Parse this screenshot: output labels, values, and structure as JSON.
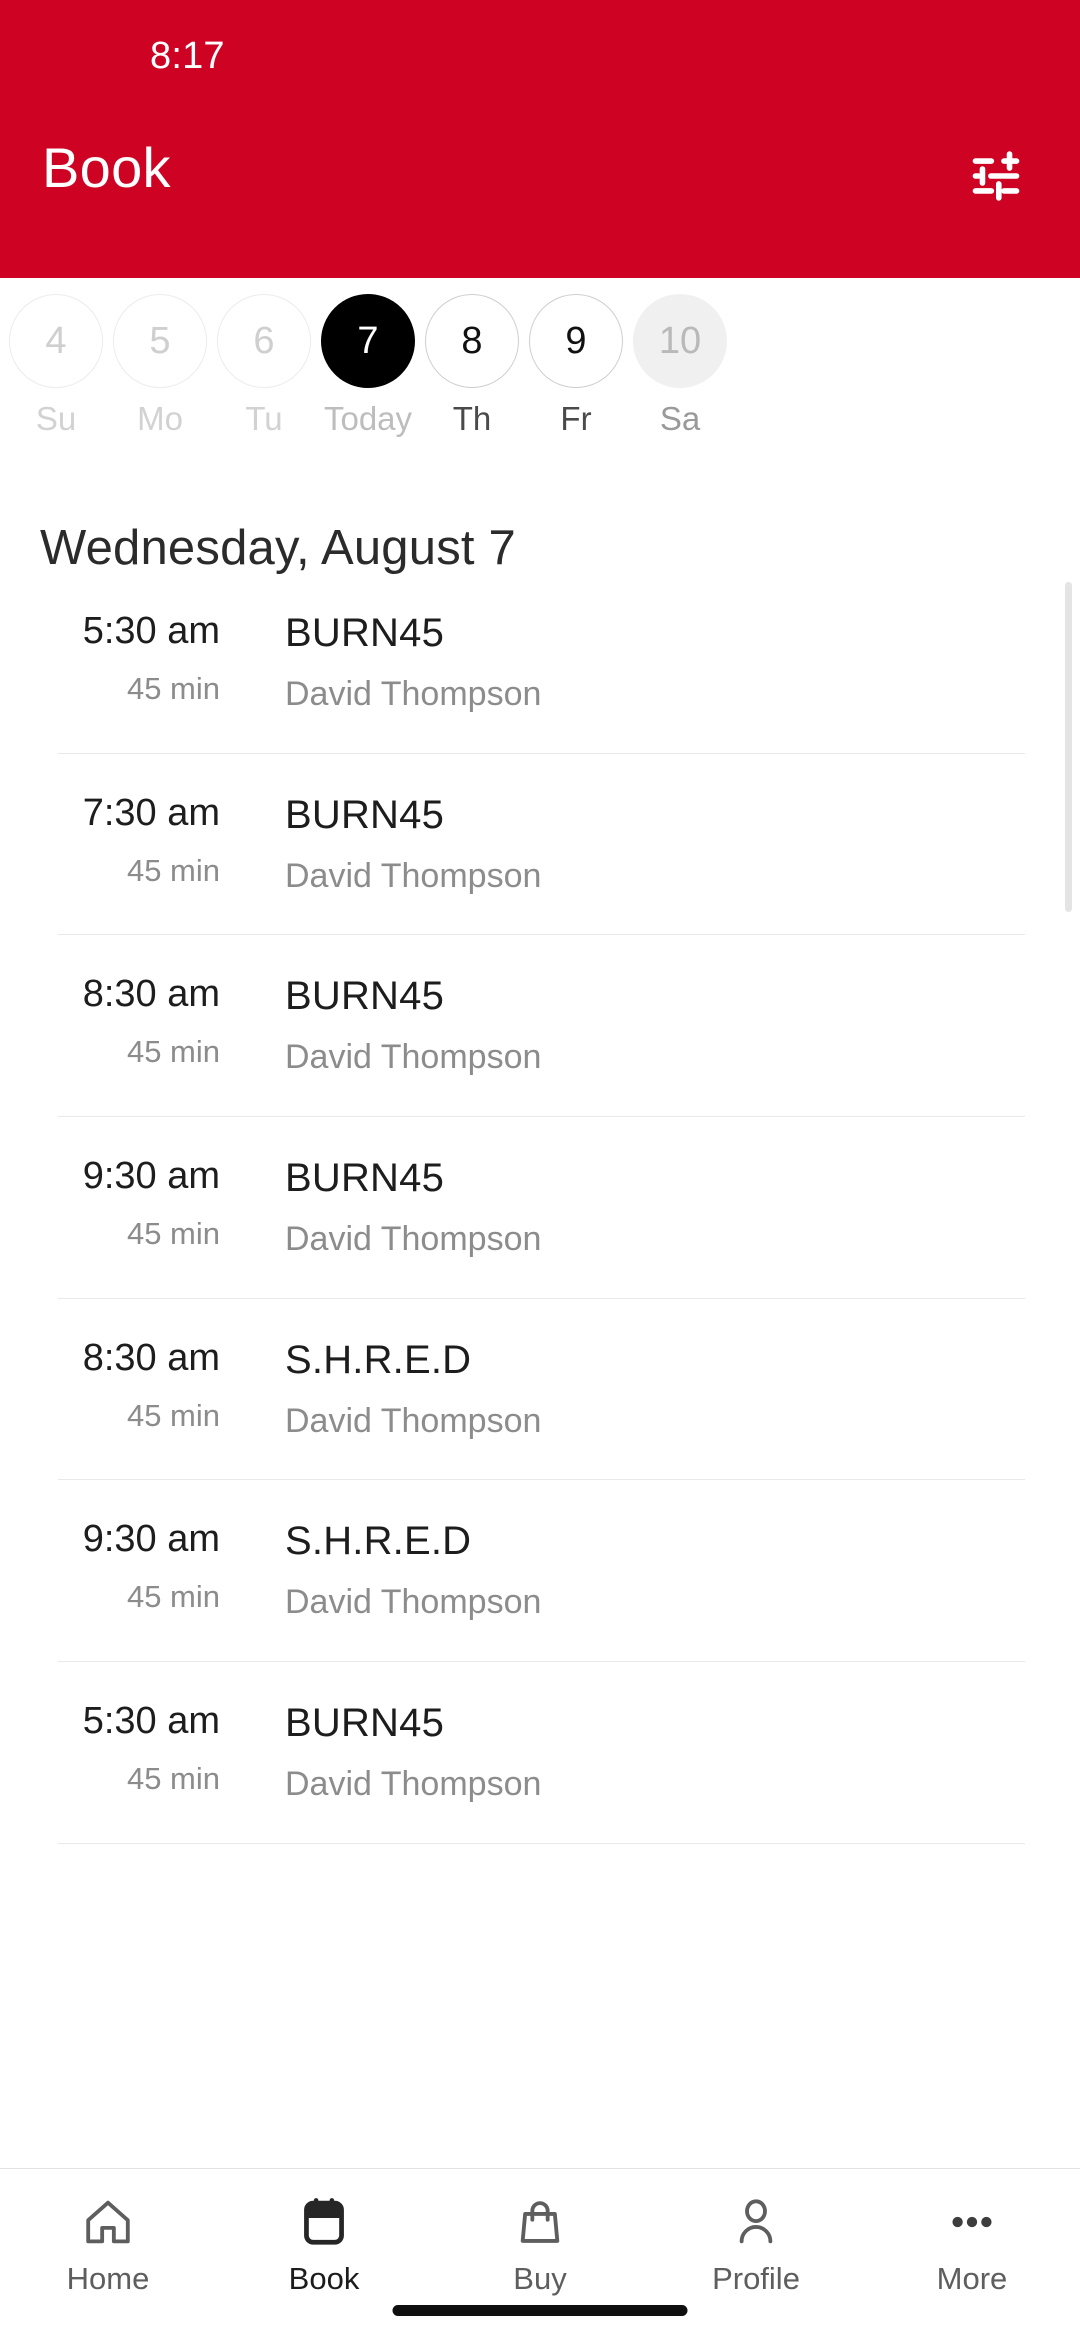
{
  "status_bar": {
    "time": "8:17"
  },
  "header": {
    "title": "Book",
    "filter_icon": "sliders-filter-icon",
    "background_color": "#CE0222",
    "text_color": "#FFFFFF"
  },
  "date_strip": {
    "days": [
      {
        "date": "4",
        "label": "Su",
        "state": "past"
      },
      {
        "date": "5",
        "label": "Mo",
        "state": "past"
      },
      {
        "date": "6",
        "label": "Tu",
        "state": "past"
      },
      {
        "date": "7",
        "label": "Today",
        "state": "today"
      },
      {
        "date": "8",
        "label": "Th",
        "state": "future"
      },
      {
        "date": "9",
        "label": "Fr",
        "state": "future"
      },
      {
        "date": "10",
        "label": "Sa",
        "state": "muted"
      }
    ]
  },
  "main": {
    "date_heading": "Wednesday, August 7",
    "classes": [
      {
        "time": "5:30 am",
        "duration": "45 min",
        "name": "BURN45",
        "instructor": "David Thompson"
      },
      {
        "time": "7:30 am",
        "duration": "45 min",
        "name": "BURN45",
        "instructor": "David Thompson"
      },
      {
        "time": "8:30 am",
        "duration": "45 min",
        "name": "BURN45",
        "instructor": "David Thompson"
      },
      {
        "time": "9:30 am",
        "duration": "45 min",
        "name": "BURN45",
        "instructor": "David Thompson"
      },
      {
        "time": "8:30 am",
        "duration": "45 min",
        "name": "S.H.R.E.D",
        "instructor": "David Thompson"
      },
      {
        "time": "9:30 am",
        "duration": "45 min",
        "name": "S.H.R.E.D",
        "instructor": "David Thompson"
      },
      {
        "time": "5:30 am",
        "duration": "45 min",
        "name": "BURN45",
        "instructor": "David Thompson"
      }
    ]
  },
  "tabbar": {
    "tabs": [
      {
        "label": "Home",
        "icon": "home-icon",
        "active": false
      },
      {
        "label": "Book",
        "icon": "calendar-icon",
        "active": true
      },
      {
        "label": "Buy",
        "icon": "bag-icon",
        "active": false
      },
      {
        "label": "Profile",
        "icon": "person-icon",
        "active": false
      },
      {
        "label": "More",
        "icon": "ellipsis-icon",
        "active": false
      }
    ]
  }
}
